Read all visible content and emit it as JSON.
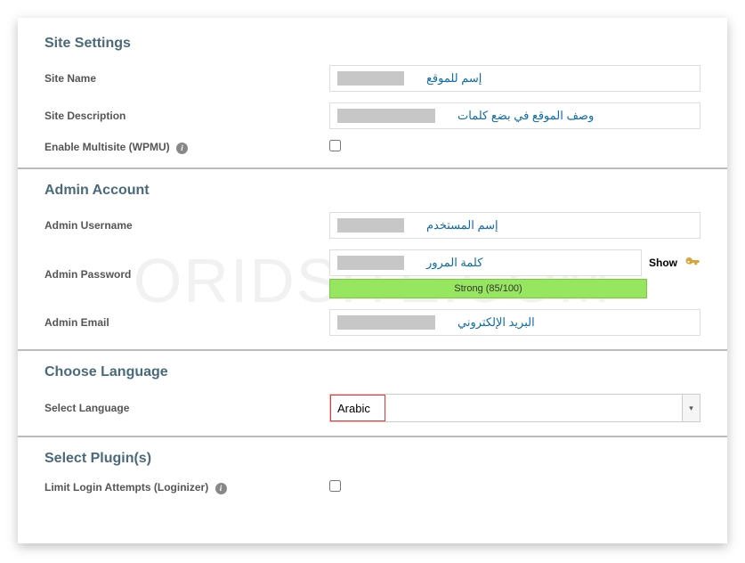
{
  "watermark": "ORIDSITE.COM",
  "sections": {
    "site_settings": {
      "title": "Site Settings",
      "site_name_label": "Site Name",
      "site_name_placeholder": "إسم للموقع",
      "site_description_label": "Site Description",
      "site_description_placeholder": "وصف الموقع في بضع كلمات",
      "enable_multisite_label": "Enable Multisite (WPMU)"
    },
    "admin_account": {
      "title": "Admin Account",
      "username_label": "Admin Username",
      "username_placeholder": "إسم المستخدم",
      "password_label": "Admin Password",
      "password_placeholder": "كلمة المرور",
      "show_button": "Show",
      "strength_text": "Strong (85/100)",
      "email_label": "Admin Email",
      "email_placeholder": "البريد الإلكتروني"
    },
    "choose_language": {
      "title": "Choose Language",
      "select_label": "Select Language",
      "selected_value": "Arabic"
    },
    "select_plugins": {
      "title": "Select Plugin(s)",
      "loginizer_label": "Limit Login Attempts (Loginizer)"
    }
  }
}
